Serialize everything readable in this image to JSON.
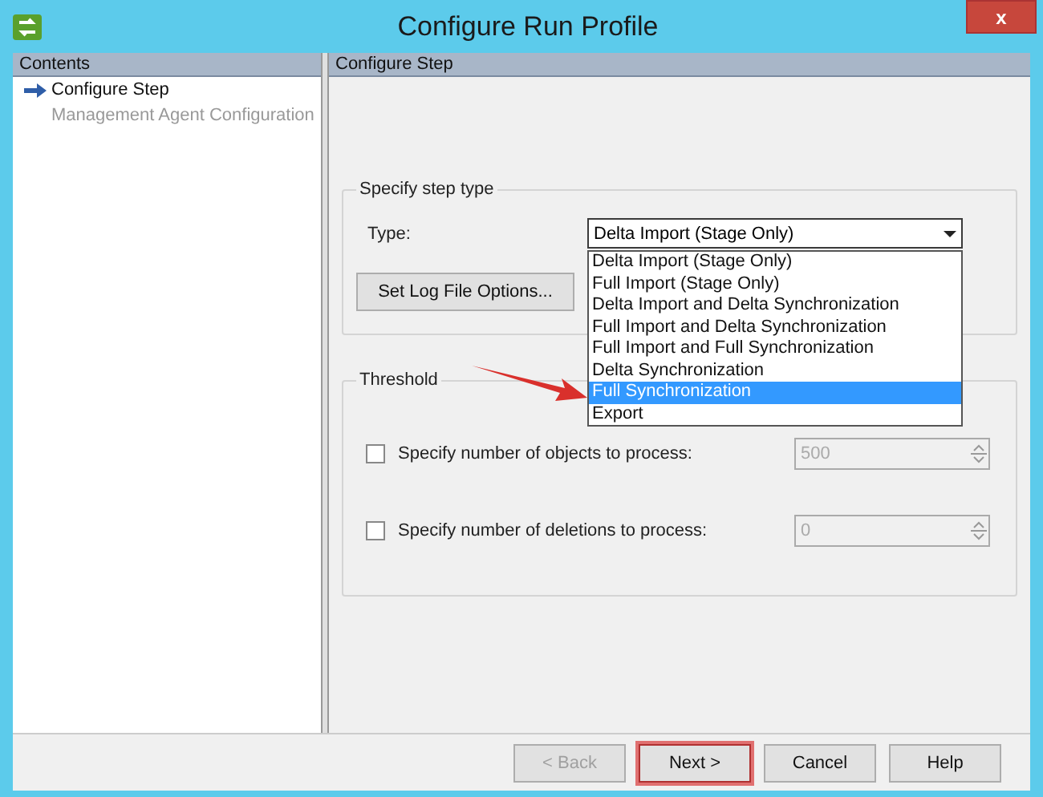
{
  "window": {
    "title": "Configure Run Profile",
    "close": "x"
  },
  "sidebar": {
    "header": "Contents",
    "items": [
      {
        "label": "Configure Step",
        "selected": true
      },
      {
        "label": "Management Agent Configuration",
        "selected": false
      }
    ]
  },
  "main": {
    "header": "Configure Step",
    "step_type": {
      "legend": "Specify step type",
      "type_label": "Type:",
      "type_value": "Delta Import (Stage Only)",
      "log_button": "Set Log File Options...",
      "dropdown": {
        "expanded": true,
        "options": [
          {
            "label": "Delta Import (Stage Only)",
            "selected": false
          },
          {
            "label": "Full Import (Stage Only)",
            "selected": false
          },
          {
            "label": "Delta Import and Delta Synchronization",
            "selected": false
          },
          {
            "label": "Full Import and Delta Synchronization",
            "selected": false
          },
          {
            "label": "Full Import and Full Synchronization",
            "selected": false
          },
          {
            "label": "Delta Synchronization",
            "selected": false
          },
          {
            "label": "Full Synchronization",
            "selected": true
          },
          {
            "label": "Export",
            "selected": false
          }
        ]
      }
    },
    "threshold": {
      "legend": "Threshold",
      "rows": [
        {
          "label": "Specify number of objects to process:",
          "checked": false,
          "value": "500",
          "disabled": true
        },
        {
          "label": "Specify number of deletions to process:",
          "checked": false,
          "value": "0",
          "disabled": true
        }
      ]
    }
  },
  "buttons": [
    {
      "label": "< Back",
      "disabled": true,
      "highlighted": false
    },
    {
      "label": "Next >",
      "disabled": false,
      "highlighted": true
    },
    {
      "label": "Cancel",
      "disabled": false,
      "highlighted": false
    },
    {
      "label": "Help",
      "disabled": false,
      "highlighted": false
    }
  ]
}
